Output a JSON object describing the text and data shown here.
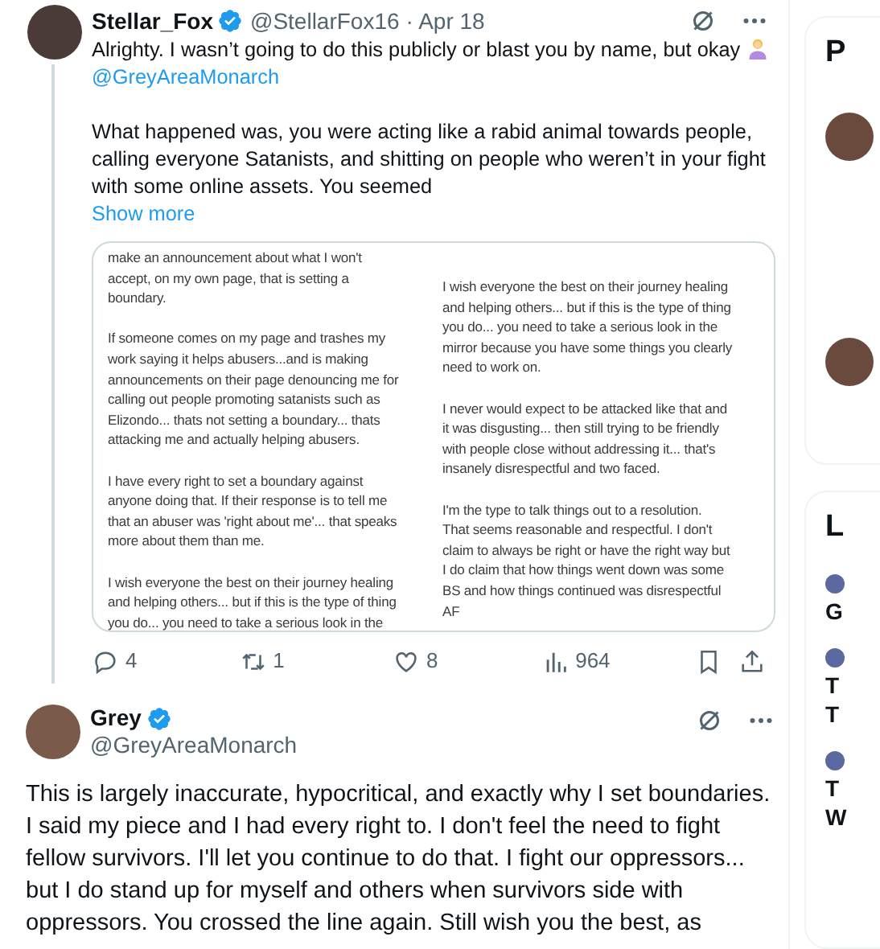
{
  "tweets": [
    {
      "display_name": "Stellar_Fox",
      "verified": true,
      "handle": "@StellarFox16",
      "date": "· Apr 18",
      "text": "Alrighty. I wasn’t going to do this publicly or blast you by name, but okay",
      "mention": "@GreyAreaMonarch",
      "paragraphs": [
        [
          "What happened was, you were acting like a rabid animal towards people,",
          "calling everyone Satanists, and shitting on people who weren’t in your fight",
          "with some online assets. You seemed"
        ]
      ],
      "show_more": "Show more",
      "image": {
        "columns": [
          [
            [
              "make an announcement about what I won't",
              "accept, on my own page, that is setting a",
              "boundary."
            ],
            [
              "If someone comes on my page and trashes my",
              "work saying it helps abusers...and is making",
              "announcements on their page denouncing me for",
              "calling out people promoting satanists such as",
              "Elizondo... thats not setting a boundary... thats",
              "attacking me and actually helping abusers."
            ],
            [
              "I have every right to set a boundary against",
              "anyone doing that. If their response is to tell me",
              "that an abuser was 'right about me'... that speaks",
              "more about them than me."
            ],
            [
              "I wish everyone the best on their journey healing",
              "and helping others... but if this is the type of thing",
              "you do... you need to take a serious look in the"
            ]
          ],
          [
            [
              "I wish everyone the best on their journey healing",
              "and helping others... but if this is the type of thing",
              "you do... you need to take a serious look in the",
              "mirror because you have some things you clearly",
              "need to work on."
            ],
            [
              "I never would expect to be attacked like that and",
              "it was disgusting... then still trying to be friendly",
              "with people close without addressing it... that's",
              "insanely disrespectful and two faced."
            ],
            [
              "I'm the type to talk things out to a resolution.",
              "That seems reasonable and respectful. I don't",
              "claim to always be right or have the right way but",
              "I do claim that how things went down was some",
              "BS and how things continued was disrespectful",
              "AF"
            ]
          ]
        ]
      },
      "actions": [
        {
          "kind": "reply",
          "count": "4"
        },
        {
          "kind": "repost",
          "count": "1"
        },
        {
          "kind": "like",
          "count": "8"
        },
        {
          "kind": "views",
          "count": "964"
        },
        {
          "kind": "bookmark"
        },
        {
          "kind": "share"
        }
      ]
    },
    {
      "display_name": "Grey",
      "verified": true,
      "handle": "@GreyAreaMonarch",
      "paragraphs": [
        [
          "This is largely inaccurate, hypocritical, and exactly why I set boundaries.",
          "I said my piece and I had every right to. I don't feel the need to fight",
          "fellow survivors. I'll let you continue to do that. I fight our oppressors...",
          "but I do stand up for myself and others when survivors side with",
          "oppressors. You crossed the line again. Still wish you the best, as"
        ]
      ]
    }
  ],
  "sidebar": {
    "cards": [
      {
        "heading": "P",
        "items": [
          {
            "kind": "avatar"
          },
          {
            "kind": "avatar"
          }
        ]
      },
      {
        "heading": "L",
        "items": [
          {
            "kind": "trend",
            "lines": [
              "G"
            ]
          },
          {
            "kind": "trend",
            "lines": [
              "T",
              "T"
            ]
          },
          {
            "kind": "trend",
            "lines": [
              "T",
              "W"
            ]
          }
        ]
      }
    ]
  }
}
